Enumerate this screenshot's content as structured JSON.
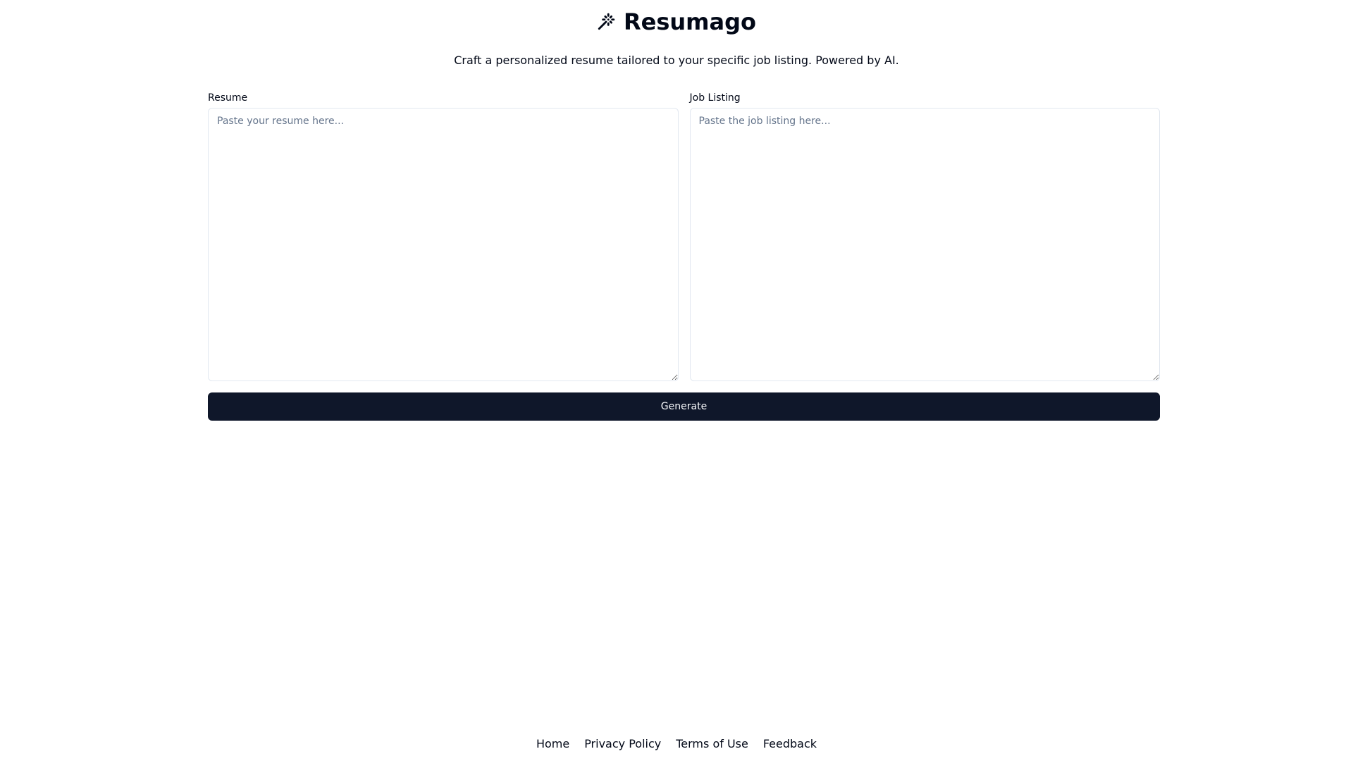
{
  "header": {
    "icon": "wand-sparkles-icon",
    "title": "Resumago",
    "tagline": "Craft a personalized resume tailored to your specific job listing. Powered by AI."
  },
  "form": {
    "resume": {
      "label": "Resume",
      "value": "",
      "placeholder": "Paste your resume here..."
    },
    "job_listing": {
      "label": "Job Listing",
      "value": "",
      "placeholder": "Paste the job listing here..."
    },
    "generate_label": "Generate"
  },
  "footer": {
    "links": [
      {
        "label": "Home"
      },
      {
        "label": "Privacy Policy"
      },
      {
        "label": "Terms of Use"
      },
      {
        "label": "Feedback"
      }
    ]
  },
  "colors": {
    "button_bg": "#0f172a",
    "button_text": "#f8fafc",
    "border": "#e2e8f0",
    "placeholder": "#64748b",
    "text": "#020817"
  }
}
